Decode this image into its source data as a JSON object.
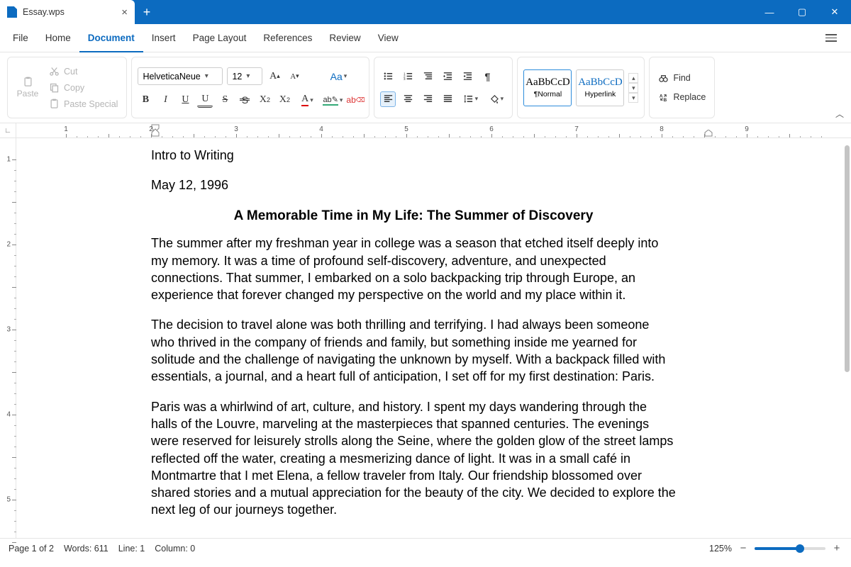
{
  "titlebar": {
    "filename": "Essay.wps"
  },
  "menus": {
    "file": "File",
    "home": "Home",
    "document": "Document",
    "insert": "Insert",
    "pagelayout": "Page Layout",
    "references": "References",
    "review": "Review",
    "view": "View"
  },
  "clipboard": {
    "paste": "Paste",
    "cut": "Cut",
    "copy": "Copy",
    "paste_special": "Paste Special"
  },
  "font": {
    "name": "HelveticaNeue",
    "size": "12",
    "case": "Aa"
  },
  "styles": {
    "normal_preview": "AaBbCcD",
    "normal_label": "¶Normal",
    "hyperlink_preview": "AaBbCcD",
    "hyperlink_label": "Hyperlink"
  },
  "editing": {
    "find": "Find",
    "replace": "Replace"
  },
  "document": {
    "line1": "Intro to Writing",
    "line2": "May 12, 1996",
    "title": "A Memorable Time in My Life: The Summer of Discovery",
    "p1": "The summer after my freshman year in college was a season that etched itself deeply into my memory. It was a time of profound self-discovery, adventure, and unexpected connections. That summer, I embarked on a solo backpacking trip through Europe, an experience that forever changed my perspective on the world and my place within it.",
    "p2": "The decision to travel alone was both thrilling and terrifying. I had always been someone who thrived in the company of friends and family, but something inside me yearned for solitude and the challenge of navigating the unknown by myself. With a backpack filled with essentials, a journal, and a heart full of anticipation, I set off for my first destination: Paris.",
    "p3": "Paris was a whirlwind of art, culture, and history. I spent my days wandering through the halls of the Louvre, marveling at the masterpieces that spanned centuries. The evenings were reserved for leisurely strolls along the Seine, where the golden glow of the street lamps reflected off the water, creating a mesmerizing dance of light. It was in a small café in Montmartre that I met Elena, a fellow traveler from Italy. Our friendship blossomed over shared stories and a mutual appreciation for the beauty of the city. We decided to explore the next leg of our journeys together."
  },
  "status": {
    "page": "Page 1 of 2",
    "words": "Words: 611",
    "line": "Line: 1",
    "column": "Column: 0",
    "zoom": "125%"
  }
}
